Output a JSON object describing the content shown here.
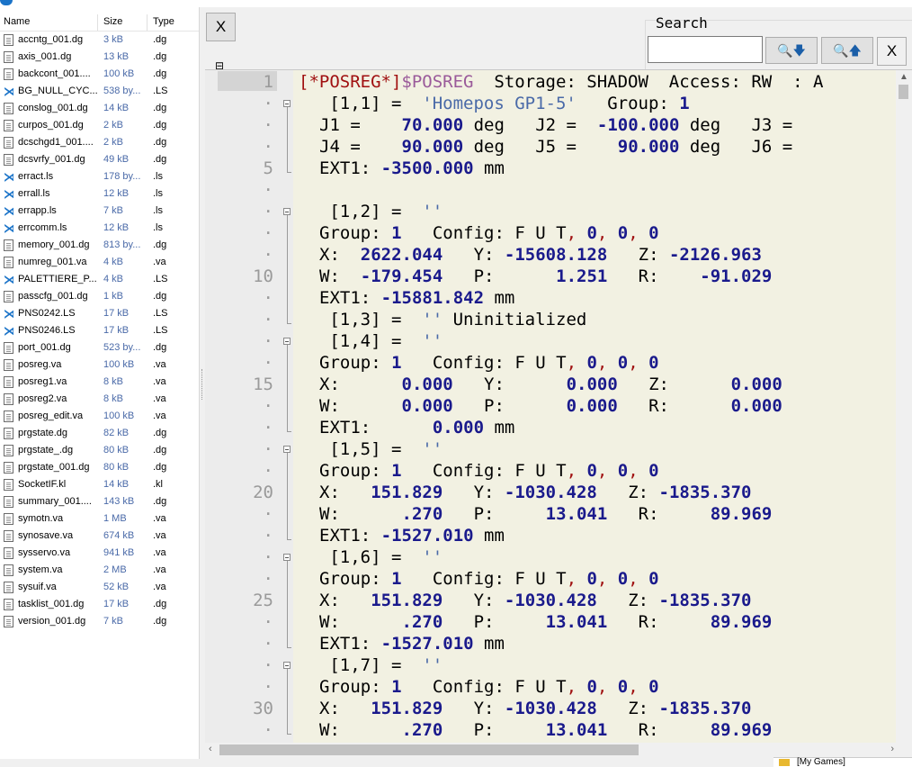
{
  "file_list": {
    "headers": {
      "name": "Name",
      "size": "Size",
      "type": "Type"
    },
    "rows": [
      {
        "name": "accntg_001.dg",
        "size": "3 kB",
        "type": ".dg",
        "icon": "document-icon"
      },
      {
        "name": "axis_001.dg",
        "size": "13 kB",
        "type": ".dg",
        "icon": "document-icon"
      },
      {
        "name": "backcont_001....",
        "size": "100 kB",
        "type": ".dg",
        "icon": "document-icon"
      },
      {
        "name": "BG_NULL_CYC...",
        "size": "538 by...",
        "type": ".LS",
        "icon": "vscode-icon"
      },
      {
        "name": "conslog_001.dg",
        "size": "14 kB",
        "type": ".dg",
        "icon": "document-icon"
      },
      {
        "name": "curpos_001.dg",
        "size": "2 kB",
        "type": ".dg",
        "icon": "document-icon"
      },
      {
        "name": "dcschgd1_001....",
        "size": "2 kB",
        "type": ".dg",
        "icon": "document-icon"
      },
      {
        "name": "dcsvrfy_001.dg",
        "size": "49 kB",
        "type": ".dg",
        "icon": "document-icon"
      },
      {
        "name": "erract.ls",
        "size": "178 by...",
        "type": ".ls",
        "icon": "vscode-icon"
      },
      {
        "name": "errall.ls",
        "size": "12 kB",
        "type": ".ls",
        "icon": "vscode-icon"
      },
      {
        "name": "errapp.ls",
        "size": "7 kB",
        "type": ".ls",
        "icon": "vscode-icon"
      },
      {
        "name": "errcomm.ls",
        "size": "12 kB",
        "type": ".ls",
        "icon": "vscode-icon"
      },
      {
        "name": "memory_001.dg",
        "size": "813 by...",
        "type": ".dg",
        "icon": "document-icon"
      },
      {
        "name": "numreg_001.va",
        "size": "4 kB",
        "type": ".va",
        "icon": "document-icon"
      },
      {
        "name": "PALETTIERE_P...",
        "size": "4 kB",
        "type": ".LS",
        "icon": "vscode-icon"
      },
      {
        "name": "passcfg_001.dg",
        "size": "1 kB",
        "type": ".dg",
        "icon": "document-icon"
      },
      {
        "name": "PNS0242.LS",
        "size": "17 kB",
        "type": ".LS",
        "icon": "vscode-icon"
      },
      {
        "name": "PNS0246.LS",
        "size": "17 kB",
        "type": ".LS",
        "icon": "vscode-icon"
      },
      {
        "name": "port_001.dg",
        "size": "523 by...",
        "type": ".dg",
        "icon": "document-icon"
      },
      {
        "name": "posreg.va",
        "size": "100 kB",
        "type": ".va",
        "icon": "document-icon"
      },
      {
        "name": "posreg1.va",
        "size": "8 kB",
        "type": ".va",
        "icon": "document-icon"
      },
      {
        "name": "posreg2.va",
        "size": "8 kB",
        "type": ".va",
        "icon": "document-icon"
      },
      {
        "name": "posreg_edit.va",
        "size": "100 kB",
        "type": ".va",
        "icon": "document-icon"
      },
      {
        "name": "prgstate.dg",
        "size": "82 kB",
        "type": ".dg",
        "icon": "document-icon"
      },
      {
        "name": "prgstate_.dg",
        "size": "80 kB",
        "type": ".dg",
        "icon": "document-icon"
      },
      {
        "name": "prgstate_001.dg",
        "size": "80 kB",
        "type": ".dg",
        "icon": "document-icon"
      },
      {
        "name": "SocketIF.kl",
        "size": "14 kB",
        "type": ".kl",
        "icon": "document-icon"
      },
      {
        "name": "summary_001....",
        "size": "143 kB",
        "type": ".dg",
        "icon": "document-icon"
      },
      {
        "name": "symotn.va",
        "size": "1 MB",
        "type": ".va",
        "icon": "document-icon"
      },
      {
        "name": "synosave.va",
        "size": "674 kB",
        "type": ".va",
        "icon": "document-icon"
      },
      {
        "name": "sysservo.va",
        "size": "941 kB",
        "type": ".va",
        "icon": "document-icon"
      },
      {
        "name": "system.va",
        "size": "2 MB",
        "type": ".va",
        "icon": "document-icon"
      },
      {
        "name": "sysuif.va",
        "size": "52 kB",
        "type": ".va",
        "icon": "document-icon"
      },
      {
        "name": "tasklist_001.dg",
        "size": "17 kB",
        "type": ".dg",
        "icon": "document-icon"
      },
      {
        "name": "version_001.dg",
        "size": "7 kB",
        "type": ".dg",
        "icon": "document-icon"
      }
    ]
  },
  "toolbar": {
    "close_left_label": "X",
    "fold_toggle_label": "⊟",
    "search_label": "Search",
    "search_value": "",
    "search_next_label": "🔍🡇",
    "search_prev_label": "🔍🡅",
    "close_search_label": "X"
  },
  "editor": {
    "line_numbers": [
      {
        "row": 0,
        "text": "1"
      },
      {
        "row": 1,
        "text": "·"
      },
      {
        "row": 2,
        "text": "·"
      },
      {
        "row": 3,
        "text": "·"
      },
      {
        "row": 4,
        "text": "5"
      },
      {
        "row": 5,
        "text": "·"
      },
      {
        "row": 6,
        "text": "·"
      },
      {
        "row": 7,
        "text": "·"
      },
      {
        "row": 8,
        "text": "·"
      },
      {
        "row": 9,
        "text": "10"
      },
      {
        "row": 10,
        "text": "·"
      },
      {
        "row": 11,
        "text": "·"
      },
      {
        "row": 12,
        "text": "·"
      },
      {
        "row": 13,
        "text": "·"
      },
      {
        "row": 14,
        "text": "15"
      },
      {
        "row": 15,
        "text": "·"
      },
      {
        "row": 16,
        "text": "·"
      },
      {
        "row": 17,
        "text": "·"
      },
      {
        "row": 18,
        "text": "·"
      },
      {
        "row": 19,
        "text": "20"
      },
      {
        "row": 20,
        "text": "·"
      },
      {
        "row": 21,
        "text": "·"
      },
      {
        "row": 22,
        "text": "·"
      },
      {
        "row": 23,
        "text": "·"
      },
      {
        "row": 24,
        "text": "25"
      },
      {
        "row": 25,
        "text": "·"
      },
      {
        "row": 26,
        "text": "·"
      },
      {
        "row": 27,
        "text": "·"
      },
      {
        "row": 28,
        "text": "·"
      },
      {
        "row": 29,
        "text": "30"
      },
      {
        "row": 30,
        "text": "·"
      }
    ],
    "lines": [
      [
        [
          "r",
          "[*POSREG*]"
        ],
        [
          "p",
          "$POSREG"
        ],
        [
          "",
          "  Storage: SHADOW  Access: RW  : A"
        ]
      ],
      [
        [
          "",
          "   [1,1] =  "
        ],
        [
          "s",
          "'Homepos GP1-5'"
        ],
        [
          "",
          "   Group: "
        ],
        [
          "k",
          "1"
        ]
      ],
      [
        [
          "",
          "J1 =    "
        ],
        [
          "k",
          "70.000"
        ],
        [
          "",
          " deg   J2 =  "
        ],
        [
          "k",
          "-100.000"
        ],
        [
          "",
          " deg   J3 ="
        ]
      ],
      [
        [
          "",
          "J4 =    "
        ],
        [
          "k",
          "90.000"
        ],
        [
          "",
          " deg   J5 =    "
        ],
        [
          "k",
          "90.000"
        ],
        [
          "",
          " deg   J6 ="
        ]
      ],
      [
        [
          "",
          "EXT1: "
        ],
        [
          "k",
          "-3500.000"
        ],
        [
          "",
          " mm"
        ]
      ],
      [
        [
          "",
          ""
        ]
      ],
      [
        [
          "",
          "   [1,2] =  "
        ],
        [
          "s",
          "''"
        ]
      ],
      [
        [
          "",
          "Group: "
        ],
        [
          "k",
          "1"
        ],
        [
          "",
          "   Config: F U T"
        ],
        [
          "r",
          ","
        ],
        [
          "k",
          " 0"
        ],
        [
          "r",
          ","
        ],
        [
          "k",
          " 0"
        ],
        [
          "r",
          ","
        ],
        [
          "k",
          " 0"
        ]
      ],
      [
        [
          "",
          "X:  "
        ],
        [
          "k",
          "2622.044"
        ],
        [
          "",
          "   Y: "
        ],
        [
          "k",
          "-15608.128"
        ],
        [
          "",
          "   Z: "
        ],
        [
          "k",
          "-2126.963"
        ]
      ],
      [
        [
          "",
          "W:  "
        ],
        [
          "k",
          "-179.454"
        ],
        [
          "",
          "   P:      "
        ],
        [
          "k",
          "1.251"
        ],
        [
          "",
          "   R:    "
        ],
        [
          "k",
          "-91.029"
        ]
      ],
      [
        [
          "",
          "EXT1: "
        ],
        [
          "k",
          "-15881.842"
        ],
        [
          "",
          " mm"
        ]
      ],
      [
        [
          "",
          "   [1,3] =  "
        ],
        [
          "s",
          "''"
        ],
        [
          "",
          " Uninitialized"
        ]
      ],
      [
        [
          "",
          "   [1,4] =  "
        ],
        [
          "s",
          "''"
        ]
      ],
      [
        [
          "",
          "Group: "
        ],
        [
          "k",
          "1"
        ],
        [
          "",
          "   Config: F U T"
        ],
        [
          "r",
          ","
        ],
        [
          "k",
          " 0"
        ],
        [
          "r",
          ","
        ],
        [
          "k",
          " 0"
        ],
        [
          "r",
          ","
        ],
        [
          "k",
          " 0"
        ]
      ],
      [
        [
          "",
          "X:      "
        ],
        [
          "k",
          "0.000"
        ],
        [
          "",
          "   Y:      "
        ],
        [
          "k",
          "0.000"
        ],
        [
          "",
          "   Z:      "
        ],
        [
          "k",
          "0.000"
        ]
      ],
      [
        [
          "",
          "W:      "
        ],
        [
          "k",
          "0.000"
        ],
        [
          "",
          "   P:      "
        ],
        [
          "k",
          "0.000"
        ],
        [
          "",
          "   R:      "
        ],
        [
          "k",
          "0.000"
        ]
      ],
      [
        [
          "",
          "EXT1:      "
        ],
        [
          "k",
          "0.000"
        ],
        [
          "",
          " mm"
        ]
      ],
      [
        [
          "",
          "   [1,5] =  "
        ],
        [
          "s",
          "''"
        ]
      ],
      [
        [
          "",
          "Group: "
        ],
        [
          "k",
          "1"
        ],
        [
          "",
          "   Config: F U T"
        ],
        [
          "r",
          ","
        ],
        [
          "k",
          " 0"
        ],
        [
          "r",
          ","
        ],
        [
          "k",
          " 0"
        ],
        [
          "r",
          ","
        ],
        [
          "k",
          " 0"
        ]
      ],
      [
        [
          "",
          "X:   "
        ],
        [
          "k",
          "151.829"
        ],
        [
          "",
          "   Y: "
        ],
        [
          "k",
          "-1030.428"
        ],
        [
          "",
          "   Z: "
        ],
        [
          "k",
          "-1835.370"
        ]
      ],
      [
        [
          "",
          "W:      "
        ],
        [
          "k",
          ".270"
        ],
        [
          "",
          "   P:     "
        ],
        [
          "k",
          "13.041"
        ],
        [
          "",
          "   R:     "
        ],
        [
          "k",
          "89.969"
        ]
      ],
      [
        [
          "",
          "EXT1: "
        ],
        [
          "k",
          "-1527.010"
        ],
        [
          "",
          " mm"
        ]
      ],
      [
        [
          "",
          "   [1,6] =  "
        ],
        [
          "s",
          "''"
        ]
      ],
      [
        [
          "",
          "Group: "
        ],
        [
          "k",
          "1"
        ],
        [
          "",
          "   Config: F U T"
        ],
        [
          "r",
          ","
        ],
        [
          "k",
          " 0"
        ],
        [
          "r",
          ","
        ],
        [
          "k",
          " 0"
        ],
        [
          "r",
          ","
        ],
        [
          "k",
          " 0"
        ]
      ],
      [
        [
          "",
          "X:   "
        ],
        [
          "k",
          "151.829"
        ],
        [
          "",
          "   Y: "
        ],
        [
          "k",
          "-1030.428"
        ],
        [
          "",
          "   Z: "
        ],
        [
          "k",
          "-1835.370"
        ]
      ],
      [
        [
          "",
          "W:      "
        ],
        [
          "k",
          ".270"
        ],
        [
          "",
          "   P:     "
        ],
        [
          "k",
          "13.041"
        ],
        [
          "",
          "   R:     "
        ],
        [
          "k",
          "89.969"
        ]
      ],
      [
        [
          "",
          "EXT1: "
        ],
        [
          "k",
          "-1527.010"
        ],
        [
          "",
          " mm"
        ]
      ],
      [
        [
          "",
          "   [1,7] =  "
        ],
        [
          "s",
          "''"
        ]
      ],
      [
        [
          "",
          "Group: "
        ],
        [
          "k",
          "1"
        ],
        [
          "",
          "   Config: F U T"
        ],
        [
          "r",
          ","
        ],
        [
          "k",
          " 0"
        ],
        [
          "r",
          ","
        ],
        [
          "k",
          " 0"
        ],
        [
          "r",
          ","
        ],
        [
          "k",
          " 0"
        ]
      ],
      [
        [
          "",
          "X:   "
        ],
        [
          "k",
          "151.829"
        ],
        [
          "",
          "   Y: "
        ],
        [
          "k",
          "-1030.428"
        ],
        [
          "",
          "   Z: "
        ],
        [
          "k",
          "-1835.370"
        ]
      ],
      [
        [
          "",
          "W:      "
        ],
        [
          "k",
          ".270"
        ],
        [
          "",
          "   P:     "
        ],
        [
          "k",
          "13.041"
        ],
        [
          "",
          "   R:     "
        ],
        [
          "k",
          "89.969"
        ]
      ]
    ],
    "fold_rows": [
      1,
      6,
      12,
      17,
      22,
      27
    ]
  },
  "taskbar": {
    "label": "[My Games]"
  },
  "colors": {
    "editor_bg": "#f2f1e2",
    "number": "#1a1a8c",
    "register": "#a01010",
    "string": "#4a6aa8"
  }
}
